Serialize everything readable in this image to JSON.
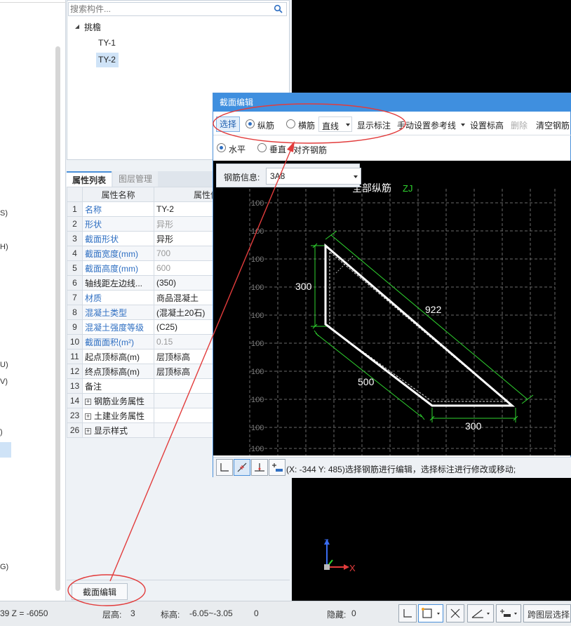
{
  "left_panel": {
    "fragments": [
      "S)",
      "H)",
      "U)",
      "V)",
      ")",
      "G)"
    ]
  },
  "tree": {
    "search_placeholder": "搜索构件...",
    "root_label": "挑檐",
    "items": [
      "TY-1",
      "TY-2"
    ]
  },
  "tabs": {
    "attr_list": "属性列表",
    "layer_mgmt": "图层管理"
  },
  "prop_table": {
    "headers": [
      "属性名称",
      "属性值"
    ],
    "rows": [
      {
        "num": "1",
        "name": "名称",
        "value": "TY-2",
        "name_blue": true,
        "value_gray": false,
        "expand": false
      },
      {
        "num": "2",
        "name": "形状",
        "value": "异形",
        "name_blue": true,
        "value_gray": true,
        "expand": false
      },
      {
        "num": "3",
        "name": "截面形状",
        "value": "异形",
        "name_blue": true,
        "value_gray": false,
        "expand": false
      },
      {
        "num": "4",
        "name": "截面宽度(mm)",
        "value": "700",
        "name_blue": true,
        "value_gray": true,
        "expand": false
      },
      {
        "num": "5",
        "name": "截面高度(mm)",
        "value": "600",
        "name_blue": true,
        "value_gray": true,
        "expand": false
      },
      {
        "num": "6",
        "name": "轴线距左边线...",
        "value": "(350)",
        "name_blue": false,
        "value_gray": false,
        "expand": false
      },
      {
        "num": "7",
        "name": "材质",
        "value": "商品混凝土",
        "name_blue": true,
        "value_gray": false,
        "expand": false
      },
      {
        "num": "8",
        "name": "混凝土类型",
        "value": "(混凝土20石)",
        "name_blue": true,
        "value_gray": false,
        "expand": false
      },
      {
        "num": "9",
        "name": "混凝土强度等级",
        "value": "(C25)",
        "name_blue": true,
        "value_gray": false,
        "expand": false
      },
      {
        "num": "10",
        "name": "截面面积(m²)",
        "value": "0.15",
        "name_blue": true,
        "value_gray": true,
        "expand": false
      },
      {
        "num": "11",
        "name": "起点顶标高(m)",
        "value": "层顶标高",
        "name_blue": false,
        "value_gray": false,
        "expand": false
      },
      {
        "num": "12",
        "name": "终点顶标高(m)",
        "value": "层顶标高",
        "name_blue": false,
        "value_gray": false,
        "expand": false
      },
      {
        "num": "13",
        "name": "备注",
        "value": "",
        "name_blue": false,
        "value_gray": false,
        "expand": false
      },
      {
        "num": "14",
        "name": "钢筋业务属性",
        "value": "",
        "name_blue": false,
        "value_gray": false,
        "expand": true
      },
      {
        "num": "23",
        "name": "土建业务属性",
        "value": "",
        "name_blue": false,
        "value_gray": false,
        "expand": true
      },
      {
        "num": "26",
        "name": "显示样式",
        "value": "",
        "name_blue": false,
        "value_gray": false,
        "expand": true
      }
    ]
  },
  "section_edit_button": "截面编辑",
  "dialog": {
    "title": "截面编辑",
    "toolbar1": {
      "select": "选择",
      "longitudinal": "纵筋",
      "transverse": "横筋",
      "line_mode": "直线",
      "show_dims": "显示标注",
      "manual_ref_line": "手动设置参考线",
      "set_elevation": "设置标高",
      "delete": "删除",
      "clear_rebar": "清空钢筋"
    },
    "toolbar2": {
      "horizontal": "水平",
      "vertical": "垂直",
      "align_rebar": "对齐钢筋"
    },
    "rebar_info_label": "钢筋信息:",
    "rebar_info_value": "3A8",
    "canvas": {
      "leader_label": "全部纵筋",
      "leader_code": "ZJ",
      "grid_label": "100",
      "dims": {
        "left": "300",
        "hyp": "922",
        "bottom_slope": "500",
        "bottom": "300"
      }
    },
    "status_text": "(X: -344 Y: 485)选择钢筋进行编辑，选择标注进行修改或移动;"
  },
  "axis_labels": {
    "z": "Z",
    "x": "X"
  },
  "bottom_bar": {
    "coord": "39 Z = -6050",
    "floor_label": "层高:",
    "floor_value": "3",
    "elev_label": "标高:",
    "elev_value": "-6.05~-3.05",
    "zero": "0",
    "hidden_label": "隐藏:",
    "hidden_value": "0",
    "cross_layer": "跨图层选择"
  },
  "colors": {
    "title_blue": "#3f8fdf",
    "annotation_red": "#e23c3c",
    "dim_green": "#2fd32f",
    "name_blue": "#2f6fc2"
  }
}
